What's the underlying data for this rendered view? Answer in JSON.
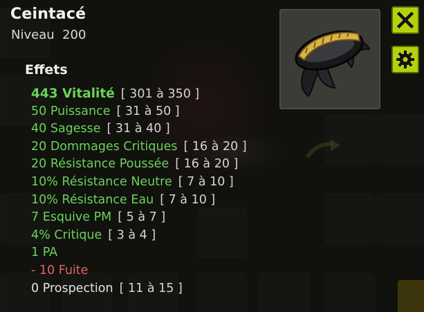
{
  "item": {
    "name": "Ceintacé",
    "level_label": "Niveau",
    "level_value": "200"
  },
  "effects_section": {
    "title": "Effets",
    "effects": [
      {
        "label": "443 Vitalité",
        "range": "[ 301 à 350 ]",
        "kind": "green"
      },
      {
        "label": "50 Puissance",
        "range": "[ 31 à 50 ]",
        "kind": "green"
      },
      {
        "label": "40 Sagesse",
        "range": "[ 31 à 40 ]",
        "kind": "green"
      },
      {
        "label": "20 Dommages Critiques",
        "range": "[ 16 à 20 ]",
        "kind": "green"
      },
      {
        "label": "20 Résistance Poussée",
        "range": "[ 16 à 20 ]",
        "kind": "green"
      },
      {
        "label": "10% Résistance Neutre",
        "range": "[ 7 à 10 ]",
        "kind": "green"
      },
      {
        "label": "10% Résistance Eau",
        "range": "[ 7 à 10 ]",
        "kind": "green"
      },
      {
        "label": "7 Esquive PM",
        "range": "[ 5 à 7 ]",
        "kind": "green"
      },
      {
        "label": "4% Critique",
        "range": "[ 3 à 4 ]",
        "kind": "green"
      },
      {
        "label": "1 PA",
        "range": "",
        "kind": "green"
      },
      {
        "label": "- 10 Fuite",
        "range": "",
        "kind": "red"
      },
      {
        "label": "0 Prospection",
        "range": "[ 11 à 15 ]",
        "kind": "white"
      }
    ]
  },
  "buttons": {
    "close_icon": "close-x-icon",
    "settings_icon": "gear-icon"
  },
  "colors": {
    "positive": "#6ad35a",
    "negative": "#e0665f",
    "neutral": "#e4e4de",
    "button_accent": "#b5d10d"
  }
}
